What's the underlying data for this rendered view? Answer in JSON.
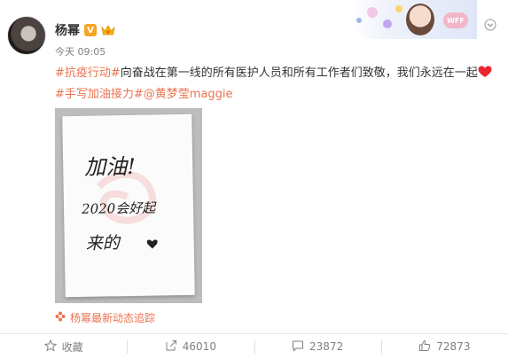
{
  "post": {
    "author": "杨幂",
    "verified_mark": "V",
    "time": "今天 09:05",
    "text": {
      "topic1": "#抗疫行动#",
      "body": "向奋战在第一线的所有医护人员和所有工作者们致敬，我们永远在一起",
      "topic2": "#手写加油接力#",
      "mention": "@黄梦莹maggie"
    },
    "image_handwriting": [
      "加油!",
      "2020会好起",
      "来的"
    ],
    "source_label": "杨幂最新动态追踪"
  },
  "banner": {
    "badge": "WFF"
  },
  "actions": {
    "favorite_label": "收藏",
    "share_count": "46010",
    "comment_count": "23872",
    "like_count": "72873"
  },
  "colors": {
    "topic": "#eb7350",
    "verified": "#f5a623",
    "muted": "#808080"
  },
  "icons": [
    "verified-icon",
    "crown-icon",
    "more-chevron-icon",
    "heart-icon",
    "flower-icon",
    "star-icon",
    "share-icon",
    "comment-icon",
    "like-icon"
  ]
}
